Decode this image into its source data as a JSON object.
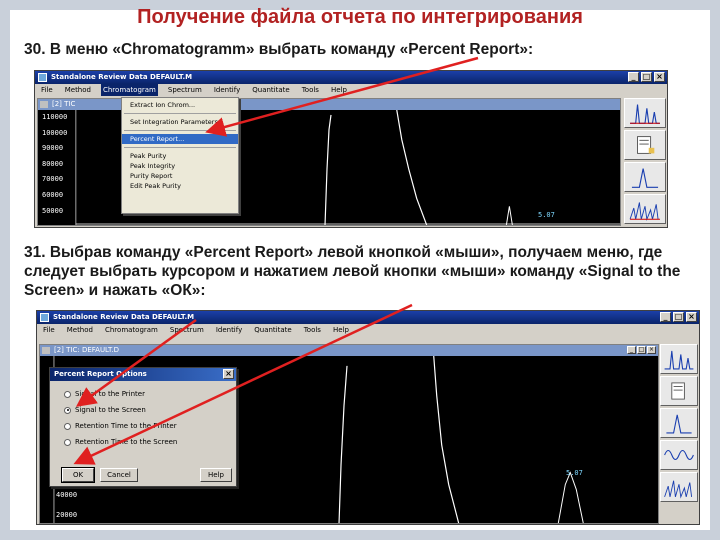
{
  "slide": {
    "title": "Получение файла отчета по интегрирования",
    "step1": "30. В меню «Chromatogramm» выбрать команду «Percent Report»:",
    "step2": "31. Выбрав команду «Percent Report» левой кнопкой «мыши», получаем меню, где следует выбрать курсором и нажатием левой кнопки «мыши» команду «Signal to the Screen» и нажать «ОК»:"
  },
  "window1": {
    "title": "Standalone Review Data  DEFAULT.M",
    "menu": [
      "File",
      "Method",
      "Chromatogram",
      "Spectrum",
      "Identify",
      "Quantitate",
      "Tools",
      "Help"
    ],
    "child_title": "[2] TIC",
    "y_labels": [
      "110000",
      "100000",
      "90000",
      "80000",
      "70000",
      "60000",
      "50000"
    ],
    "peak_label": "5.07",
    "dropdown_items": [
      "Extract Ion Chrom...",
      "Set Integration Parameters...",
      "Percent Report...",
      "Peak Purity",
      "Peak Integrity",
      "Purity Report",
      "Edit Peak Purity"
    ],
    "selected_item": "Percent Report..."
  },
  "window2": {
    "title": "Standalone Review Data  DEFAULT.M",
    "menu": [
      "File",
      "Method",
      "Chromatogram",
      "Spectrum",
      "Identify",
      "Quantitate",
      "Tools",
      "Help"
    ],
    "child_title": "[2] TIC: DEFAULT.D",
    "y_labels": [
      "40000",
      "20000"
    ],
    "peak_label": "5.07",
    "dialog": {
      "title": "Percent Report Options",
      "options": [
        "Signal to the Printer",
        "Signal to the Screen",
        "Retention Time to the Printer",
        "Retention Time to the Screen"
      ],
      "selected": 1,
      "ok": "OK",
      "cancel": "Cancel",
      "help": "Help"
    }
  },
  "colors": {
    "title_red": "#b22222",
    "arrow_red": "#e02020",
    "menu_highlight": "#316ac5"
  }
}
